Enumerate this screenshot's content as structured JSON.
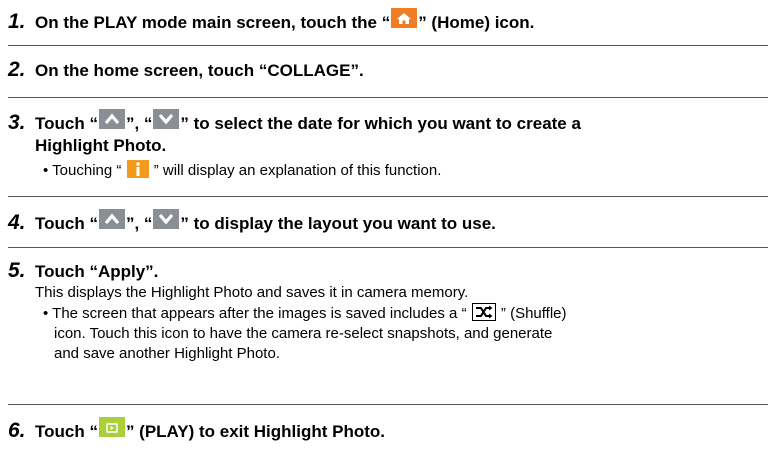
{
  "steps": [
    {
      "number": "1.",
      "text_before": "On the PLAY mode main screen, touch the “",
      "icon": "home-icon",
      "text_after": "” (Home) icon."
    },
    {
      "number": "2.",
      "text": "On the home screen, touch “COLLAGE”."
    },
    {
      "number": "3.",
      "text_a": "Touch “",
      "icon_a": "up-arrow-icon",
      "text_b": "”, “",
      "icon_b": "down-arrow-icon",
      "text_c": "” to select the date for which you want to create a",
      "continuation": "Highlight Photo.",
      "bullet_before": "Touching “",
      "bullet_icon": "info-icon",
      "bullet_after": "” will display an explanation of this function."
    },
    {
      "number": "4.",
      "text_a": "Touch “",
      "icon_a": "up-arrow-icon",
      "text_b": "”, “",
      "icon_b": "down-arrow-icon",
      "text_c": "” to display the layout you want to use."
    },
    {
      "number": "5.",
      "text": "Touch “Apply”.",
      "paragraph": "This displays the Highlight Photo and saves it in camera memory.",
      "bullet_before": "The screen that appears after the images is saved includes a “",
      "bullet_icon": "shuffle-icon",
      "bullet_after": "” (Shuffle)",
      "bullet_line2": "icon. Touch this icon to have the camera re-select snapshots, and generate",
      "bullet_line3": "and save another Highlight Photo."
    },
    {
      "number": "6.",
      "text_before": "Touch “",
      "icon": "play-icon",
      "text_after": "” (PLAY) to exit Highlight Photo."
    }
  ],
  "bullet_char": "•",
  "colors": {
    "home_icon_bg": "#f07c24",
    "arrow_icon_bg": "#8a8f95",
    "info_icon_bg": "#f39a1e",
    "play_icon_bg": "#a9cf3a",
    "rule": "#555555"
  }
}
